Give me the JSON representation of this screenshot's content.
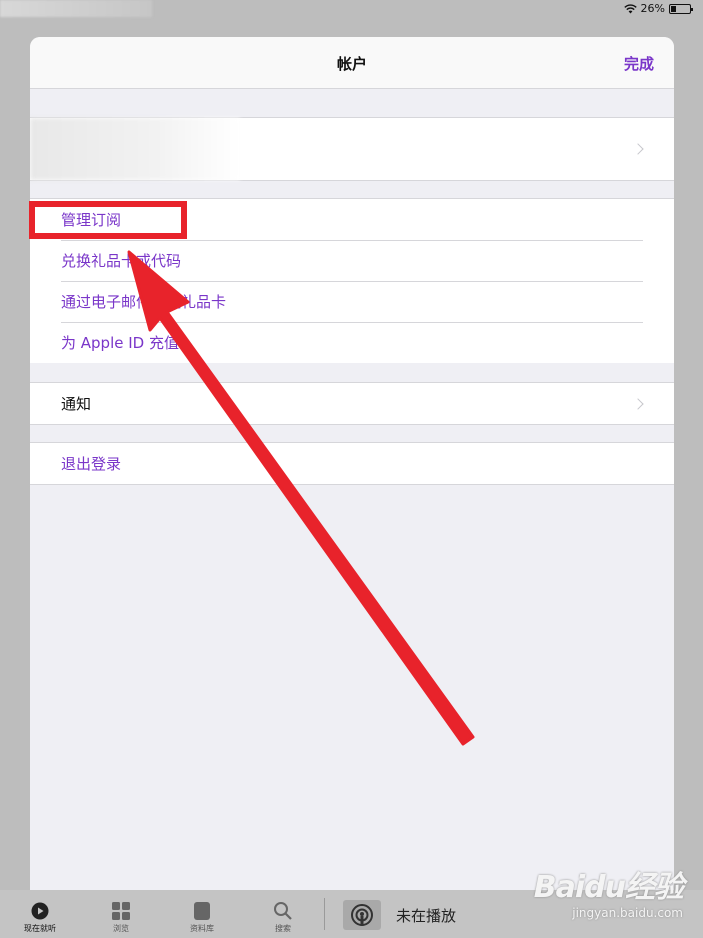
{
  "status": {
    "battery": "26%",
    "battery_level": 0.26
  },
  "sheet": {
    "title": "帐户",
    "done": "完成",
    "links": [
      {
        "label": "管理订阅"
      },
      {
        "label": "兑换礼品卡或代码"
      },
      {
        "label": "通过电子邮件发送礼品卡"
      },
      {
        "label": "为 Apple ID 充值"
      }
    ],
    "notifications": "通知",
    "sign_out": "退出登录"
  },
  "tabbar": {
    "tabs": [
      {
        "label": "现在就听",
        "icon": "play-circle-icon"
      },
      {
        "label": "浏览",
        "icon": "grid-icon"
      },
      {
        "label": "资料库",
        "icon": "library-icon"
      },
      {
        "label": "搜索",
        "icon": "search-icon"
      }
    ],
    "now_playing": "未在播放"
  },
  "watermark": {
    "brand": "Baidu经验",
    "url": "jingyan.baidu.com"
  },
  "colors": {
    "accent": "#7a36c9",
    "annotation": "#e8232b"
  }
}
